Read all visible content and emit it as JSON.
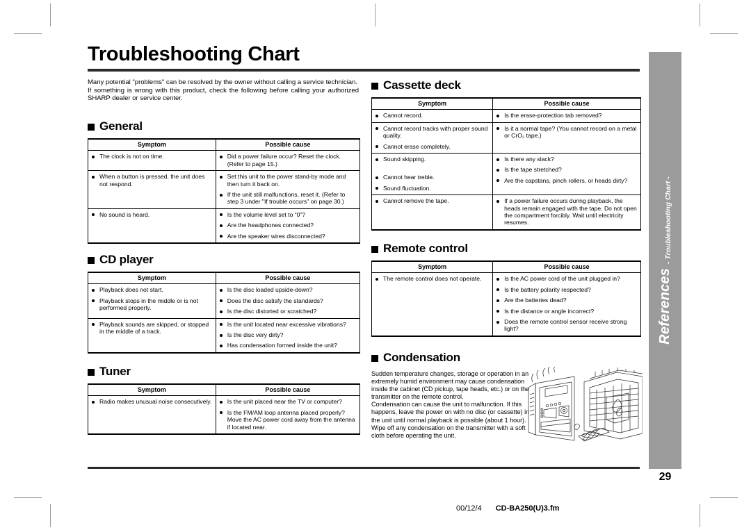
{
  "page": {
    "title": "Troubleshooting Chart",
    "number": "29"
  },
  "intro": {
    "para1": "Many potential \"problems\" can be resolved by the owner without calling a service technician.",
    "para2": "If something is wrong with this product, check the following before calling your authorized SHARP dealer or service center."
  },
  "table_headers": {
    "symptom": "Symptom",
    "cause": "Possible cause"
  },
  "sections": {
    "general": {
      "heading": "General",
      "rows": [
        {
          "symptoms": [
            "The clock is not on time."
          ],
          "causes": [
            "Did a power failure occur? Reset the clock. (Refer to page 15.)"
          ]
        },
        {
          "symptoms": [
            "When a button is pressed, the unit does not respond."
          ],
          "causes": [
            "Set this unit to the power stand-by mode and then turn it back on.",
            "If the unit still malfunctions, reset it. (Refer to step 3 under \"If trouble occurs\" on page 30.)"
          ]
        },
        {
          "symptoms": [
            "No sound is heard."
          ],
          "causes": [
            "Is the volume level set to “0”?",
            "Are the headphones connected?",
            "Are the speaker wires disconnected?"
          ]
        }
      ]
    },
    "cd_player": {
      "heading": "CD player",
      "rows": [
        {
          "symptoms": [
            "Playback does not start.",
            "Playback stops in the middle or is not performed properly."
          ],
          "causes": [
            "Is the disc loaded upside-down?",
            "Does the disc satisfy the standards?",
            "Is the disc distorted or scratched?"
          ]
        },
        {
          "symptoms": [
            "Playback sounds are skipped, or stopped in the middle of a track."
          ],
          "causes": [
            "Is the unit located near excessive vibrations?",
            "Is the disc very dirty?",
            "Has condensation formed inside the unit?"
          ]
        }
      ]
    },
    "tuner": {
      "heading": "Tuner",
      "rows": [
        {
          "symptoms": [
            "Radio makes unusual noise consecutively."
          ],
          "causes": [
            "Is the unit placed near the TV or computer?",
            "Is the FM/AM loop antenna placed properly? Move the AC power cord away from the antenna if located near."
          ]
        }
      ]
    },
    "cassette_deck": {
      "heading": "Cassette deck",
      "rows": [
        {
          "symptoms": [
            "Cannot record."
          ],
          "causes": [
            "Is the erase-protection tab removed?"
          ]
        },
        {
          "symptoms": [
            "Cannot record tracks with proper sound quality.",
            "Cannot erase completely."
          ],
          "causes": [
            "Is it a normal tape? (You cannot record on a metal or CrO₂ tape.)"
          ]
        },
        {
          "symptoms": [
            "Sound skipping.",
            "",
            "Cannot hear treble.",
            "Sound fluctuation."
          ],
          "causes": [
            "Is there any slack?",
            "Is the tape stretched?",
            "Are the capstans, pinch rollers, or heads dirty?"
          ]
        },
        {
          "symptoms": [
            "Cannot remove the tape."
          ],
          "causes": [
            "If a power failure occurs during playback, the heads remain engaged with the tape. Do not open the compartment forcibly. Wait until electricity resumes."
          ]
        }
      ]
    },
    "remote_control": {
      "heading": "Remote control",
      "rows": [
        {
          "symptoms": [
            "The remote control does not operate."
          ],
          "causes": [
            "Is the AC power cord of the unit plugged in?",
            "Is the battery polarity respected?",
            "Are the batteries dead?",
            "Is the distance or angle incorrect?",
            "Does the remote control sensor receive strong light?"
          ]
        }
      ]
    },
    "condensation": {
      "heading": "Condensation",
      "para1": "Sudden temperature changes, storage or operation in an extremely humid environment may cause condensation inside the cabinet (CD pickup, tape heads, etc.) or on the transmitter on the remote control.",
      "para2": "Condensation can cause the unit to malfunction. If this happens, leave the power on with no disc (or cassette) in the unit until normal playback is possible (about 1 hour). Wipe off any condensation on the transmitter with a soft cloth before operating the unit."
    }
  },
  "side_tab": {
    "main": "References",
    "sub": "- Troubleshooting Chart -"
  },
  "footer": {
    "date": "00/12/4",
    "filename": "CD-BA250(U)3.fm"
  }
}
